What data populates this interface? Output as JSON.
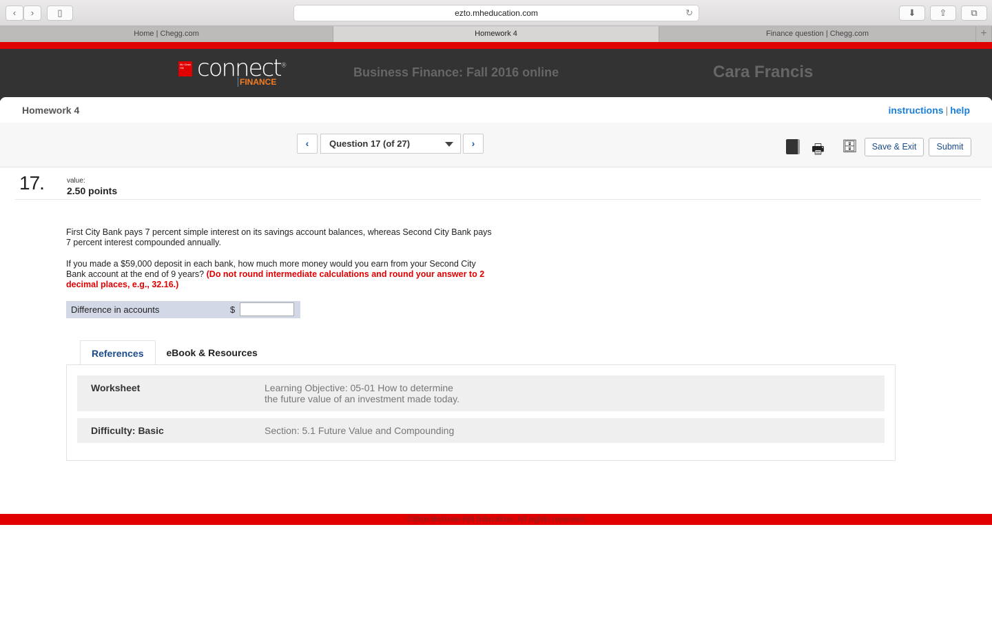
{
  "browser": {
    "url": "ezto.mheducation.com",
    "tabs": [
      {
        "label": "Home | Chegg.com"
      },
      {
        "label": "Homework 4",
        "active": true
      },
      {
        "label": "Finance question | Chegg.com"
      }
    ]
  },
  "header": {
    "logo_text": "connect",
    "logo_sub": "FINANCE",
    "course": "Business Finance: Fall 2016 online",
    "user": "Cara Francis",
    "brand_color": "#e00000"
  },
  "assignment": {
    "title": "Homework 4",
    "instructions": "instructions",
    "sep": "|",
    "help": "help"
  },
  "toolbar": {
    "question_select": "Question 17 (of 27)",
    "save_exit": "Save & Exit",
    "submit": "Submit",
    "icons": [
      "book-icon",
      "print-icon",
      "file-cabinet-icon"
    ]
  },
  "question": {
    "number": "17.",
    "value_label": "value:",
    "points": "2.50 points",
    "p1": "First City Bank pays 7 percent simple interest on its savings account balances, whereas Second City Bank pays 7 percent interest compounded annually.",
    "p2": "If you made a $59,000 deposit in each bank, how much more money would you earn from your Second City Bank account at the end of 9 years?",
    "p2_red": "(Do not round intermediate calculations and round your answer to 2 decimal places, e.g., 32.16.)",
    "answer_label": "Difference in accounts",
    "currency": "$",
    "answer_value": ""
  },
  "references": {
    "tabs": [
      {
        "label": "References",
        "active": true
      },
      {
        "label": "eBook & Resources"
      }
    ],
    "rows": [
      {
        "key": "Worksheet",
        "value_line1": "Learning Objective: 05-01 How to determine",
        "value_line2": "the future value of an investment made today."
      },
      {
        "key": "Difficulty: Basic",
        "value_line1": "Section: 5.1 Future Value and Compounding"
      }
    ]
  },
  "footer": {
    "text": "©2016 McGraw-Hill Education. All rights reserved."
  }
}
